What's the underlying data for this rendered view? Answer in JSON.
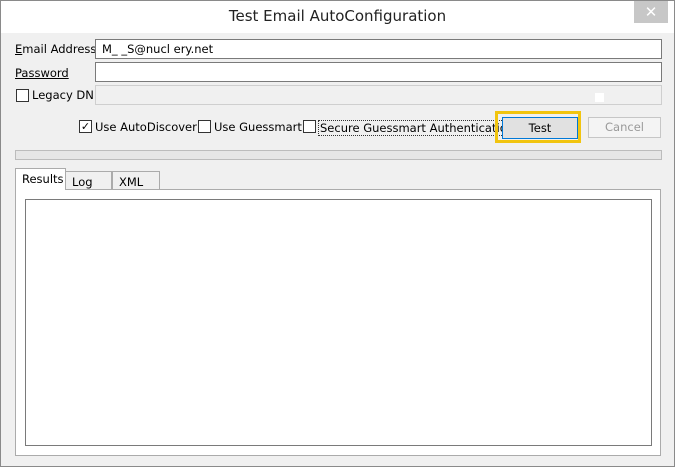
{
  "window": {
    "title": "Test Email AutoConfiguration",
    "close_glyph": "✕"
  },
  "form": {
    "email_label": "Email Address",
    "email_value": "M_ _S@nucl           ery.net",
    "password_label": "Password",
    "password_value": "",
    "legacy_dn_label": "Legacy DN",
    "legacy_dn_checked": false,
    "legacy_dn_value": ""
  },
  "options": {
    "use_autodiscover_label": "Use AutoDiscover",
    "use_autodiscover_checked": true,
    "use_guessmart_label": "Use Guessmart",
    "use_guessmart_checked": false,
    "secure_guessmart_label": "Secure Guessmart Authentication",
    "secure_guessmart_checked": false
  },
  "buttons": {
    "test_label": "Test",
    "cancel_label": "Cancel"
  },
  "progress": {
    "value": 0
  },
  "tabs": [
    {
      "label": "Results",
      "active": true
    },
    {
      "label": "Log",
      "active": false
    },
    {
      "label": "XML",
      "active": false
    }
  ],
  "results": {
    "text": ""
  },
  "colors": {
    "highlight": "#f1c40f",
    "close_button": "#c7c7c7"
  },
  "icons": {
    "close": "close-icon",
    "check": "check-icon"
  }
}
